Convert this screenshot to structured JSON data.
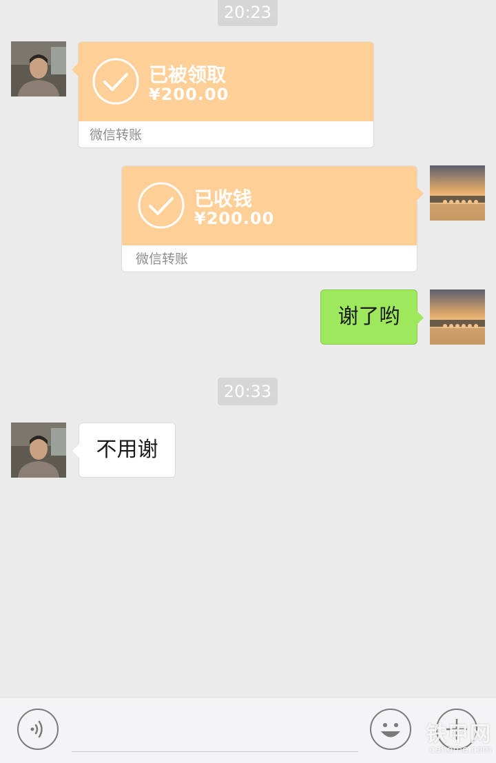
{
  "timestamps": [
    "20:23",
    "20:33"
  ],
  "messages": [
    {
      "sender": "contact",
      "type": "transfer",
      "status": "已被领取",
      "amount": "¥200.00",
      "footer": "微信转账"
    },
    {
      "sender": "me",
      "type": "transfer",
      "status": "已收钱",
      "amount": "¥200.00",
      "footer": "微信转账"
    },
    {
      "sender": "me",
      "type": "text",
      "text": "谢了哟"
    },
    {
      "sender": "contact",
      "type": "text",
      "text": "不用谢"
    }
  ],
  "input_bar": {
    "voice_icon": "voice-icon",
    "emoji_icon": "emoji-icon",
    "plus_icon": "plus-icon"
  },
  "watermark": {
    "main": "铁甲网",
    "sub": "cehome.com"
  },
  "colors": {
    "background": "#ebebeb",
    "transfer_orange": "#ffcf98",
    "sent_green": "#9ee85e",
    "timestamp_pill": "#d6d6d6"
  }
}
